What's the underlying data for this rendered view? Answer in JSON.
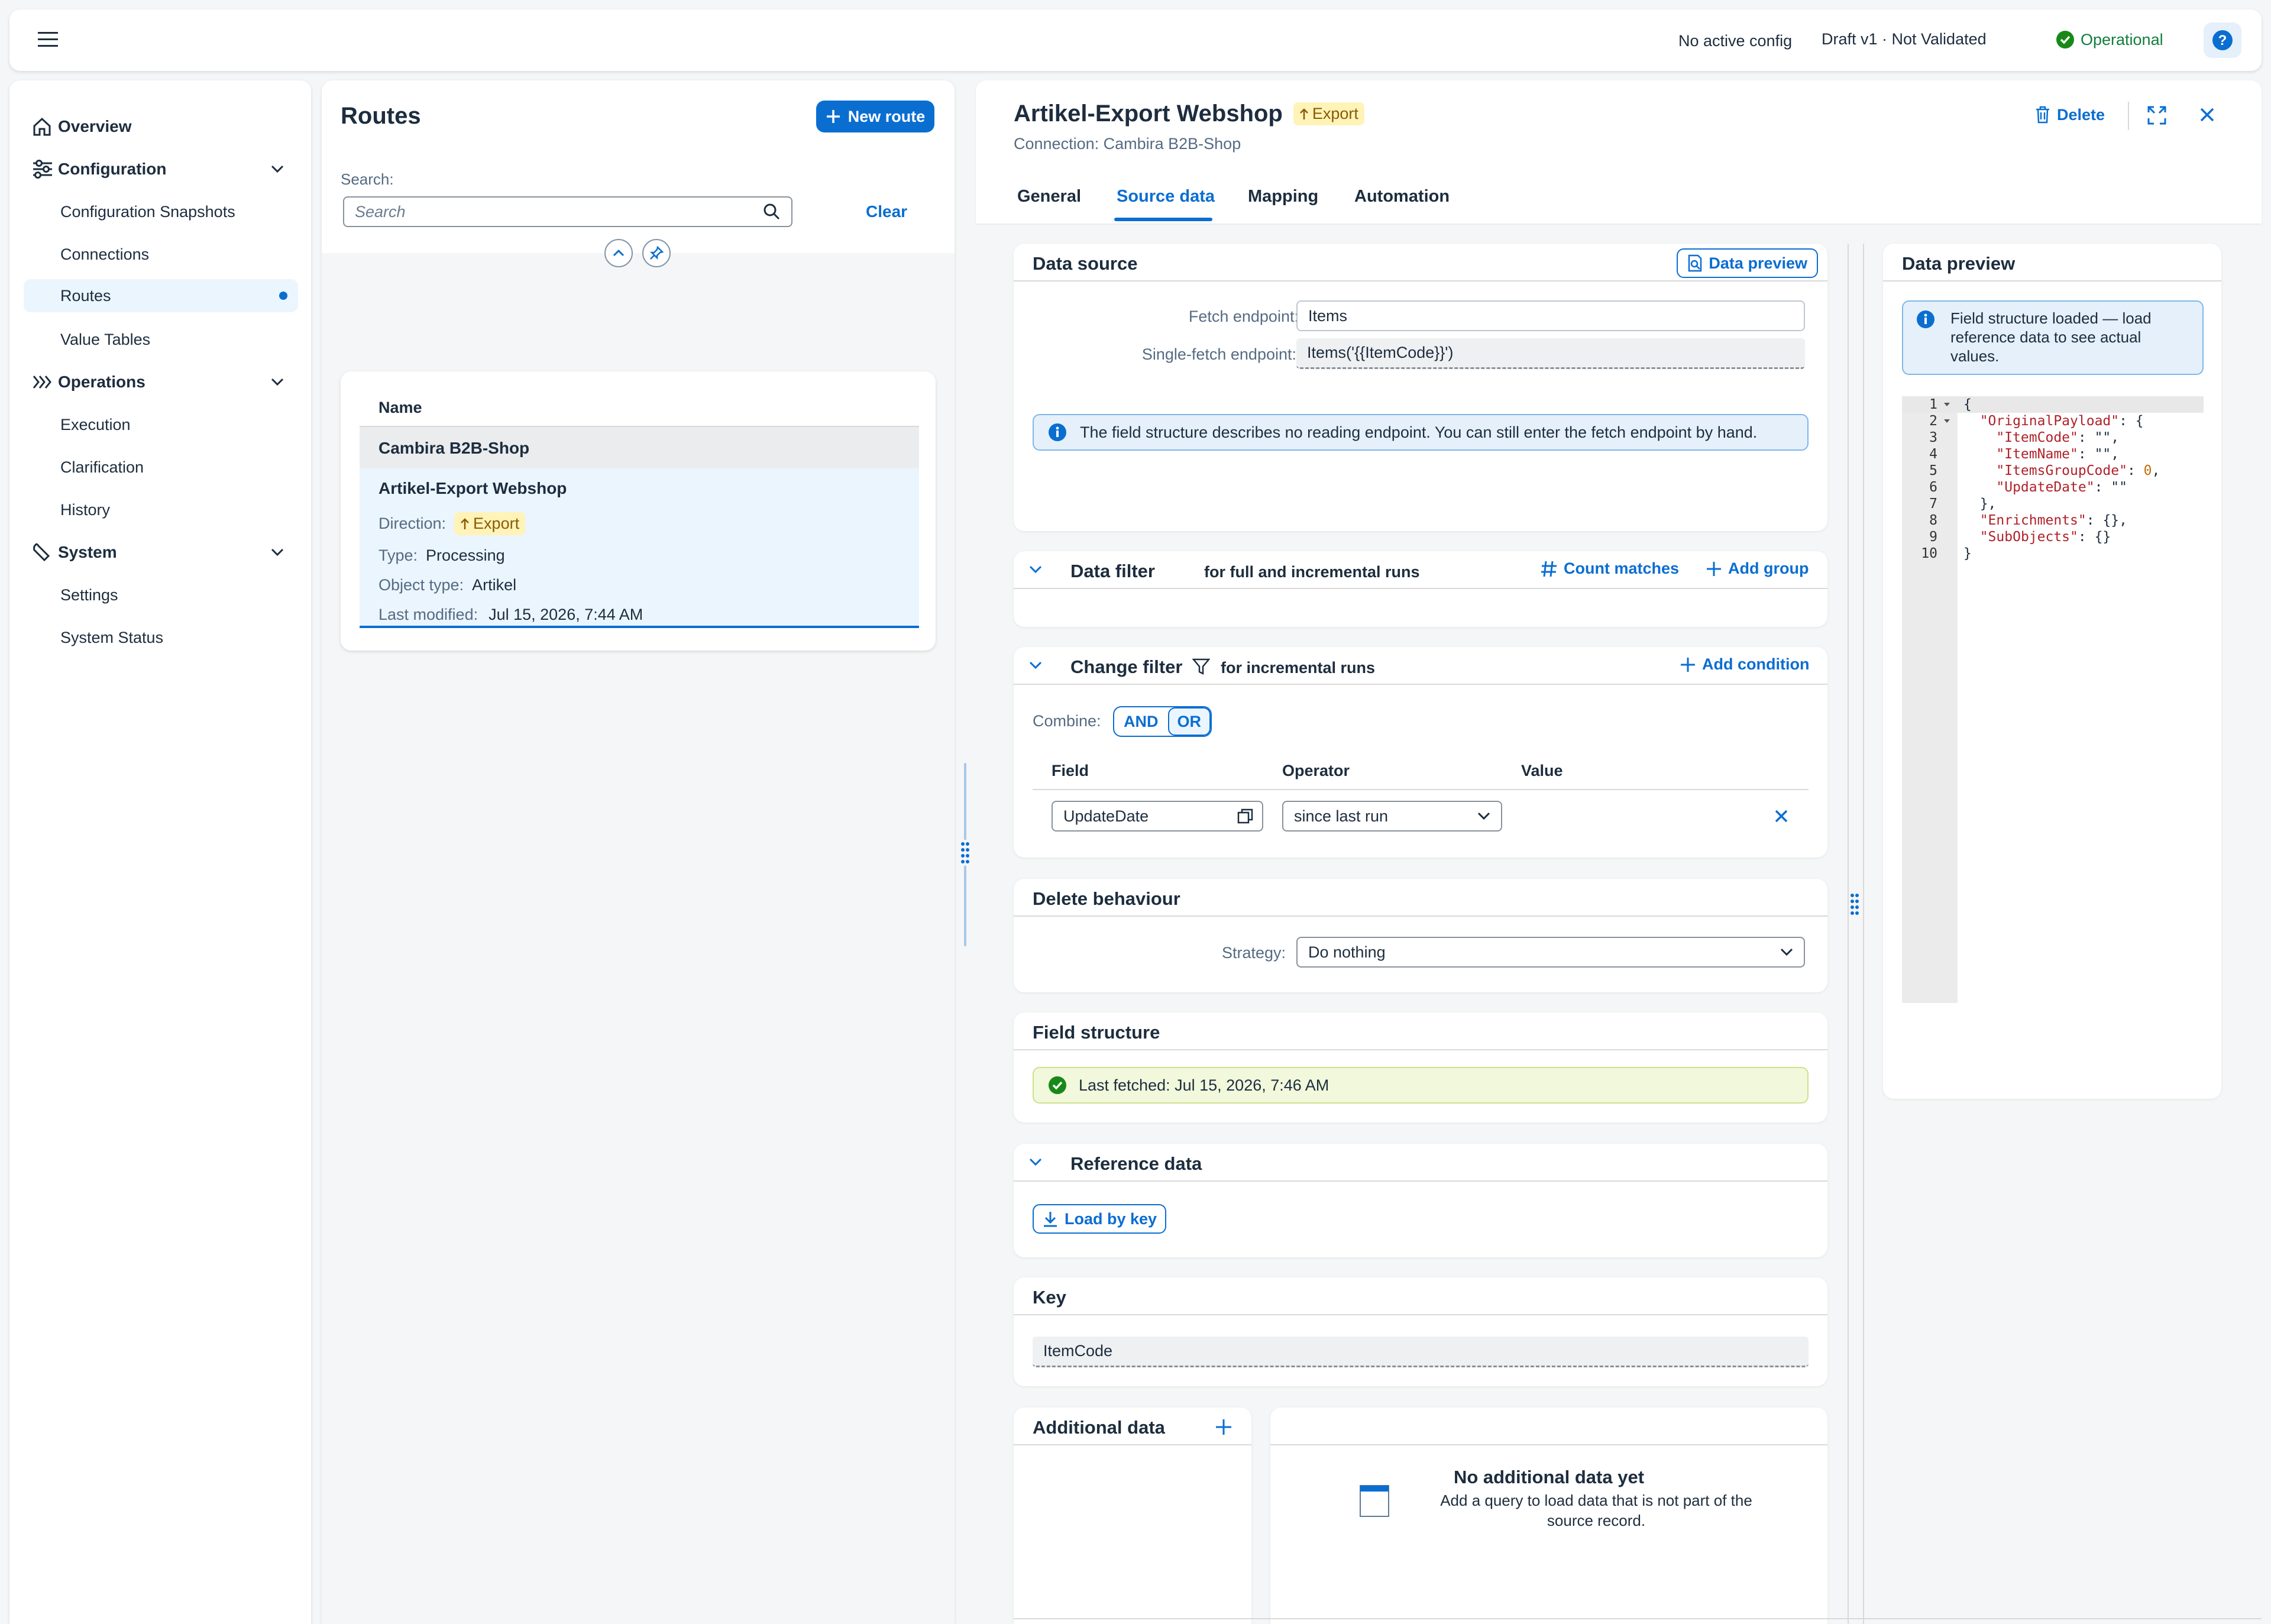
{
  "shell": {
    "menu_icon": "hamburger-menu-icon",
    "config_status": "No active config",
    "draft_status": "Draft v1 · Not Validated",
    "operational": "Operational",
    "help_icon": "help-icon"
  },
  "nav": {
    "overview": "Overview",
    "configuration": "Configuration",
    "config_snapshots": "Configuration Snapshots",
    "connections": "Connections",
    "routes": "Routes",
    "value_tables": "Value Tables",
    "operations": "Operations",
    "execution": "Execution",
    "clarification": "Clarification",
    "history": "History",
    "system": "System",
    "settings": "Settings",
    "system_status": "System Status"
  },
  "routes": {
    "title": "Routes",
    "new_route": "New route",
    "search_label": "Search:",
    "search_placeholder": "Search",
    "clear": "Clear",
    "table_header": "Name",
    "group_name": "Cambira B2B-Shop",
    "item": {
      "name": "Artikel-Export Webshop",
      "direction_label": "Direction:",
      "direction_value": "Export",
      "type_label": "Type:",
      "type_value": "Processing",
      "object_type_label": "Object type:",
      "object_type_value": "Artikel",
      "last_modified_label": "Last modified:",
      "last_modified_value": "Jul 15, 2026, 7:44 AM"
    }
  },
  "detail": {
    "title": "Artikel-Export Webshop",
    "badge": "Export",
    "subtitle": "Connection: Cambira B2B-Shop",
    "delete": "Delete",
    "tabs": [
      "General",
      "Source data",
      "Mapping",
      "Automation"
    ],
    "data_source": {
      "title": "Data source",
      "preview_btn": "Data preview",
      "fetch_label": "Fetch endpoint:",
      "fetch_value": "Items",
      "single_label": "Single-fetch endpoint:",
      "single_value": "Items('{{ItemCode}}')",
      "info": "The field structure describes no reading endpoint. You can still enter the fetch endpoint by hand."
    },
    "data_filter": {
      "title": "Data filter",
      "subtitle": "for full and incremental runs",
      "count": "Count matches",
      "add_group": "Add group"
    },
    "change_filter": {
      "title": "Change filter",
      "subtitle": "for incremental runs",
      "add_condition": "Add condition",
      "combine_label": "Combine:",
      "and": "AND",
      "or": "OR",
      "col_field": "Field",
      "col_operator": "Operator",
      "col_value": "Value",
      "row_field": "UpdateDate",
      "row_operator": "since last run"
    },
    "delete_behaviour": {
      "title": "Delete behaviour",
      "strategy_label": "Strategy:",
      "strategy_value": "Do nothing"
    },
    "field_structure": {
      "title": "Field structure",
      "status": "Last fetched: Jul 15, 2026, 7:46 AM"
    },
    "reference_data": {
      "title": "Reference data",
      "load_by_key": "Load by key"
    },
    "key": {
      "title": "Key",
      "value": "ItemCode"
    },
    "additional": {
      "title": "Additional data",
      "empty_title": "No additional data yet",
      "empty_text_1": "Add a query to load data that is not part of the",
      "empty_text_2": "source record."
    },
    "preview": {
      "title": "Data preview",
      "info_1": "Field structure loaded — load",
      "info_2": "reference data to see actual",
      "info_3": "values.",
      "line_numbers": [
        "1",
        "2",
        "3",
        "4",
        "5",
        "6",
        "7",
        "8",
        "9",
        "10"
      ],
      "code": {
        "l1": "{",
        "l2_key": "\"OriginalPayload\"",
        "l2_rest": ": {",
        "l3_key": "\"ItemCode\"",
        "l3_rest": ": \"\",",
        "l4_key": "\"ItemName\"",
        "l4_rest": ": \"\",",
        "l5_key": "\"ItemsGroupCode\"",
        "l5_sep": ": ",
        "l5_num": "0",
        "l5_end": ",",
        "l6_key": "\"UpdateDate\"",
        "l6_rest": ": \"\"",
        "l7": "},",
        "l8_key": "\"Enrichments\"",
        "l8_rest": ": {},",
        "l9_key": "\"SubObjects\"",
        "l9_rest": ": {}",
        "l10": "}"
      }
    }
  }
}
